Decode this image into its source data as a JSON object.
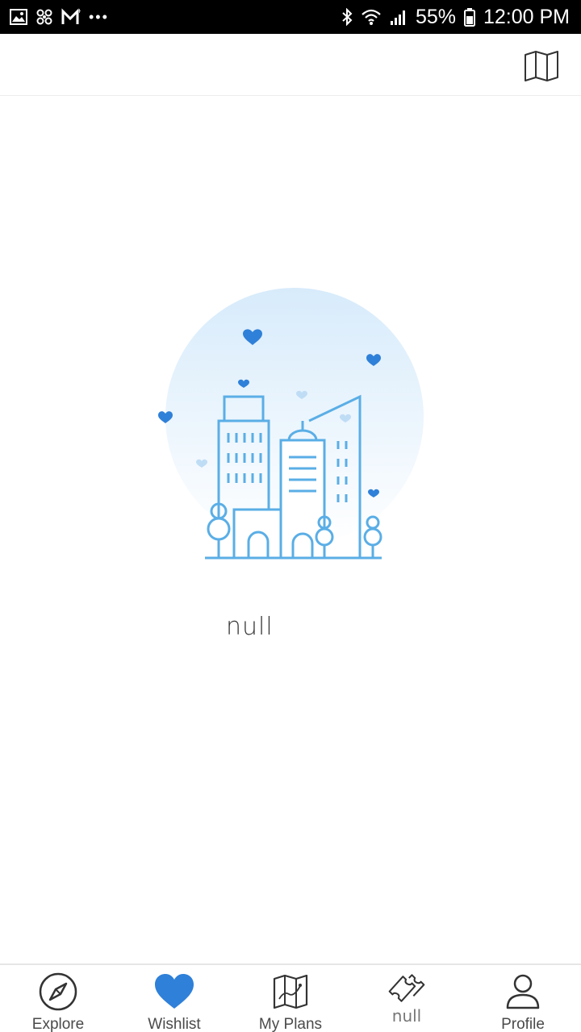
{
  "status_bar": {
    "left_icons": [
      "image-icon",
      "pinwheel-icon",
      "gmail-icon",
      "more-notifications-icon"
    ],
    "battery": "55%",
    "time": "12:00 PM",
    "right_icons": [
      "bluetooth-icon",
      "wifi-icon",
      "signal-icon",
      "battery-icon"
    ]
  },
  "app_bar": {
    "action_icon": "map-icon"
  },
  "empty_state": {
    "illustration": "city-buildings-with-hearts",
    "message": "null",
    "accent_color": "#2f80d8"
  },
  "bottom_nav": {
    "items": [
      {
        "label": "Explore",
        "icon": "compass-icon"
      },
      {
        "label": "Wishlist",
        "icon": "heart-icon",
        "active": true
      },
      {
        "label": "My Plans",
        "icon": "folded-map-icon"
      },
      {
        "label": "null",
        "icon": "tickets-icon"
      },
      {
        "label": "Profile",
        "icon": "person-icon"
      }
    ]
  }
}
